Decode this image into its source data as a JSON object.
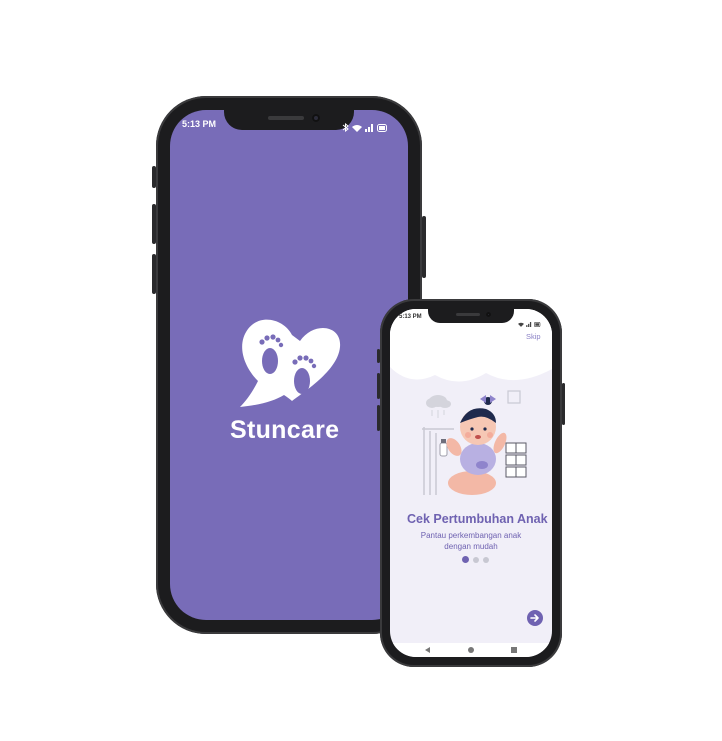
{
  "splash": {
    "status_time": "5:13 PM",
    "app_name": "Stuncare",
    "background": "#786cb8"
  },
  "onboarding": {
    "status_time": "5:13 PM",
    "skip_label": "Skip",
    "title": "Cek Pertumbuhan Anak",
    "subtitle_line1": "Pantau perkembangan anak",
    "subtitle_line2": "dengan mudah",
    "page_indicator": {
      "total": 3,
      "active": 1
    },
    "next_icon": "arrow-right-icon",
    "nav_icons": [
      "back-icon",
      "home-icon",
      "recents-icon"
    ]
  },
  "colors": {
    "brand": "#786cb8",
    "accent": "#6f62b1",
    "inactive_dot": "#c8c8d2",
    "screen_bg": "#f1eff8"
  }
}
